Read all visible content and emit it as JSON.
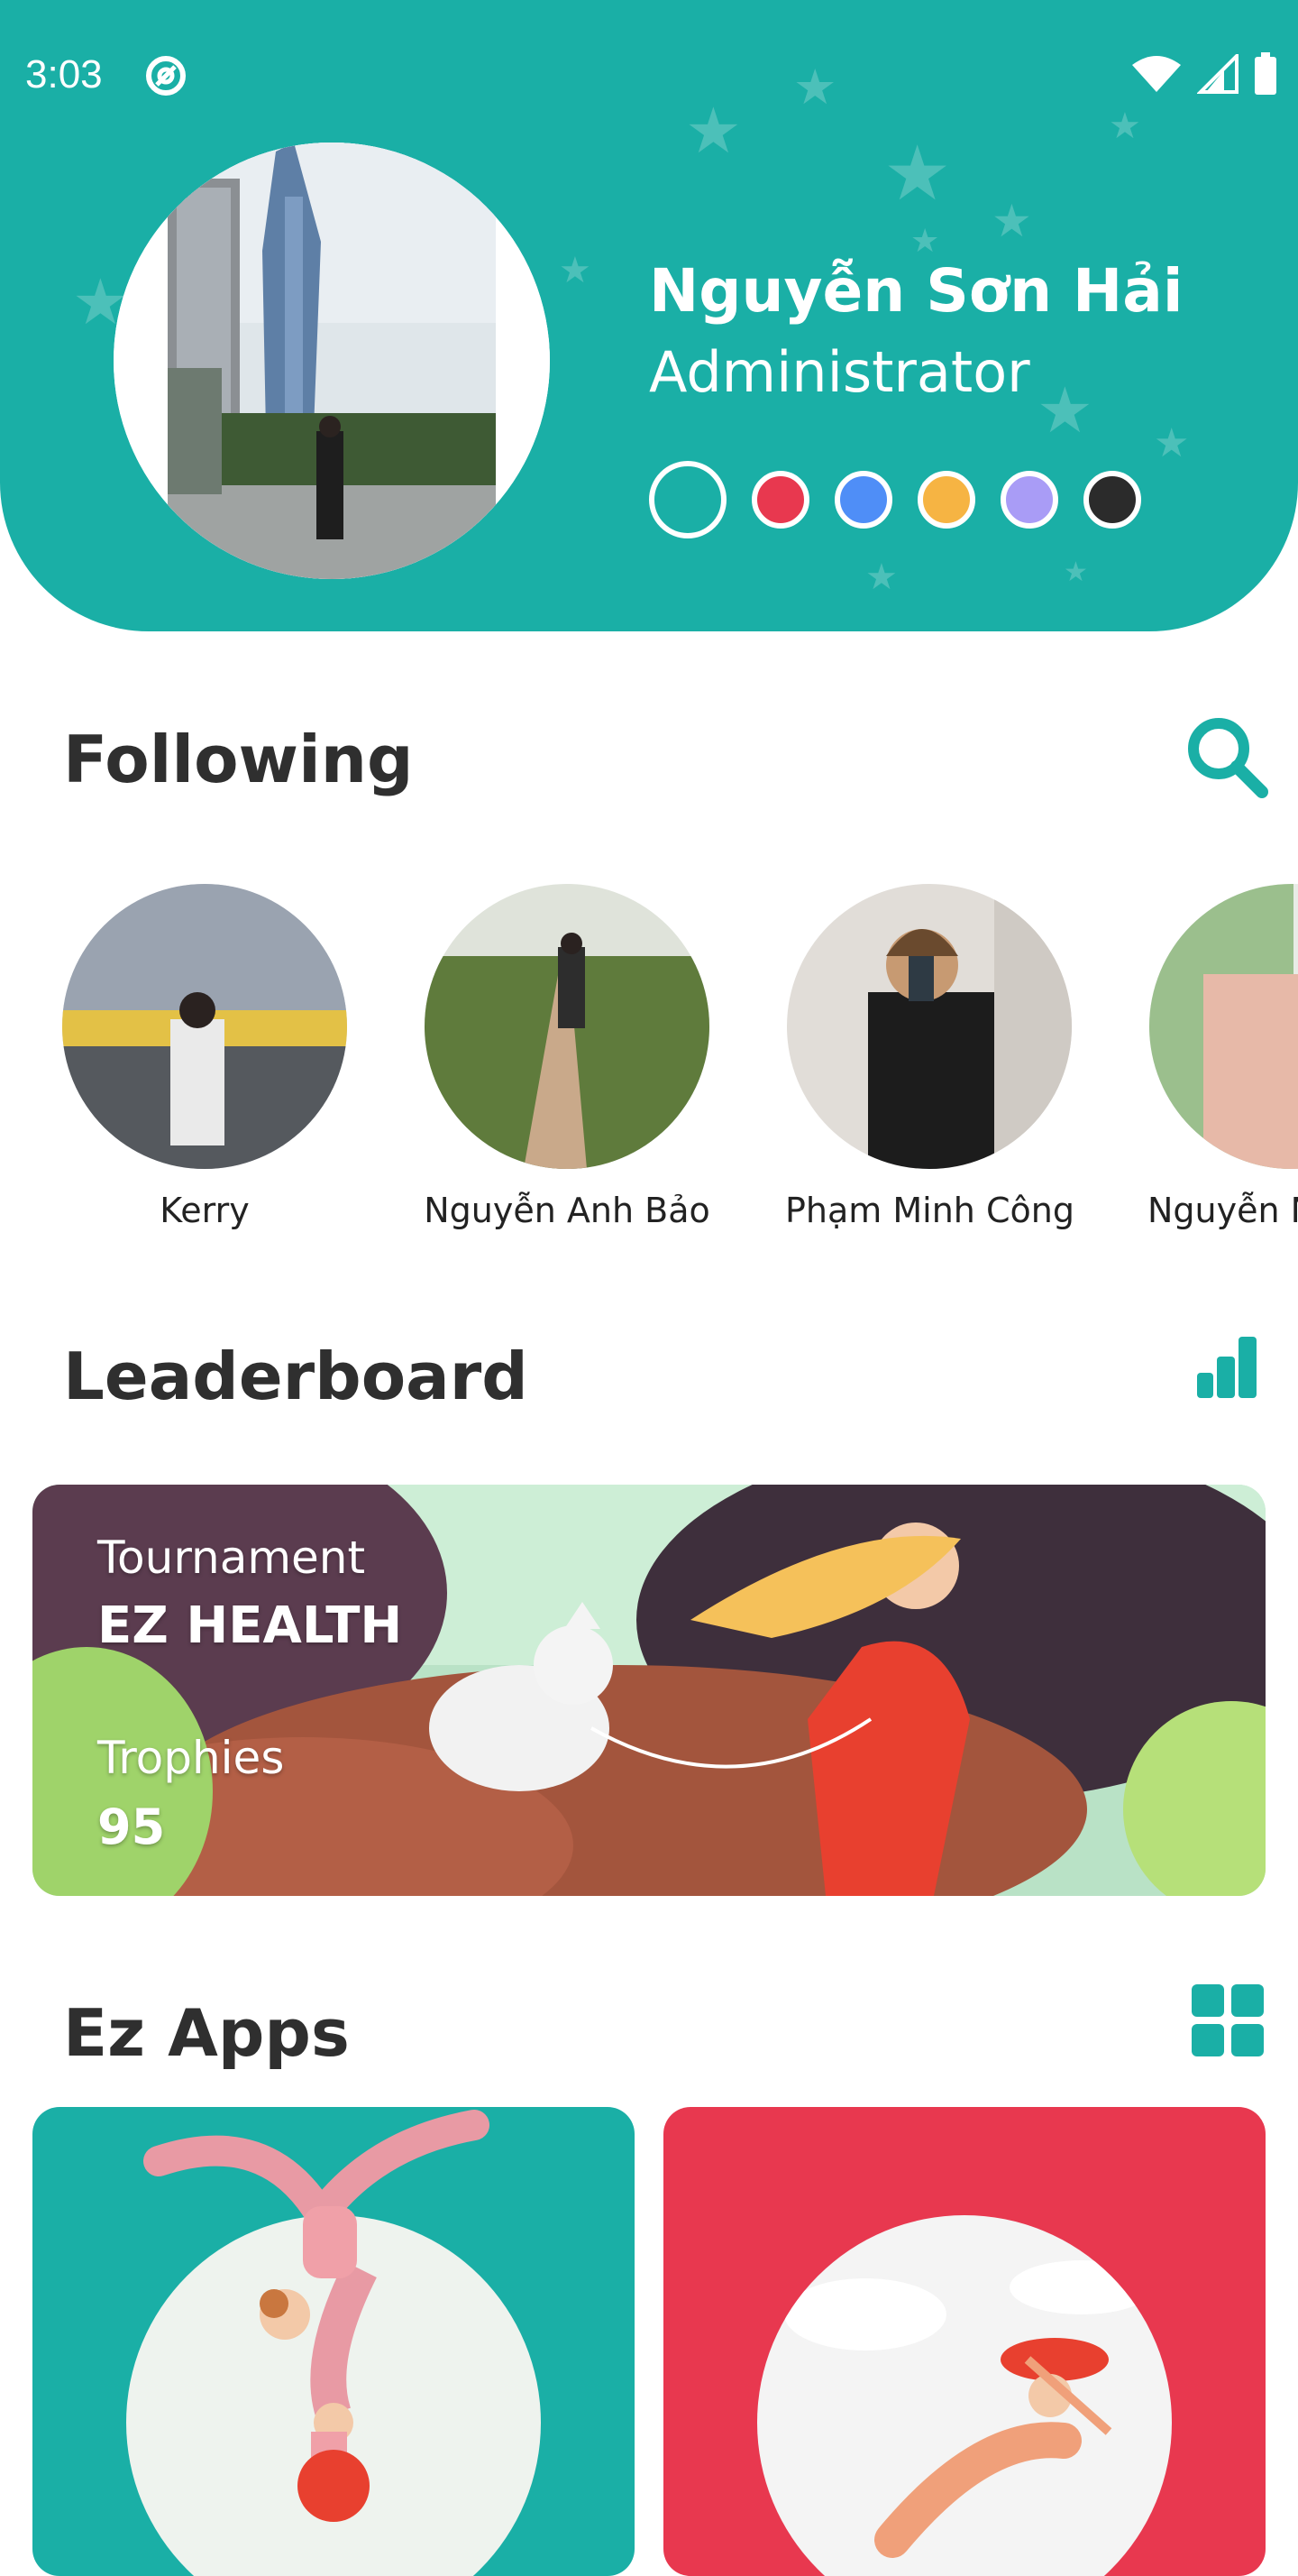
{
  "status_bar": {
    "time": "3:03"
  },
  "profile": {
    "name": "Nguyễn Sơn Hải",
    "role": "Administrator",
    "theme_colors": [
      "#1aafa6",
      "#e8384f",
      "#4f8ef7",
      "#f6b443",
      "#a99cf6",
      "#2b2b2b"
    ],
    "selected_color": "#1aafa6"
  },
  "following": {
    "title": "Following",
    "people": [
      {
        "name": "Kerry"
      },
      {
        "name": "Nguyễn Anh Bảo"
      },
      {
        "name": "Phạm Minh Công"
      },
      {
        "name": "Nguyễn N"
      }
    ]
  },
  "leaderboard": {
    "title": "Leaderboard",
    "tournament_label": "Tournament",
    "tournament_name": "EZ HEALTH",
    "trophies_label": "Trophies",
    "trophies_value": "95"
  },
  "apps": {
    "title": "Ez Apps",
    "cards": [
      {
        "color": "#1aafa6"
      },
      {
        "color": "#e8384f"
      }
    ]
  },
  "colors": {
    "accent": "#1aafa6",
    "text": "#2f2f2f"
  }
}
